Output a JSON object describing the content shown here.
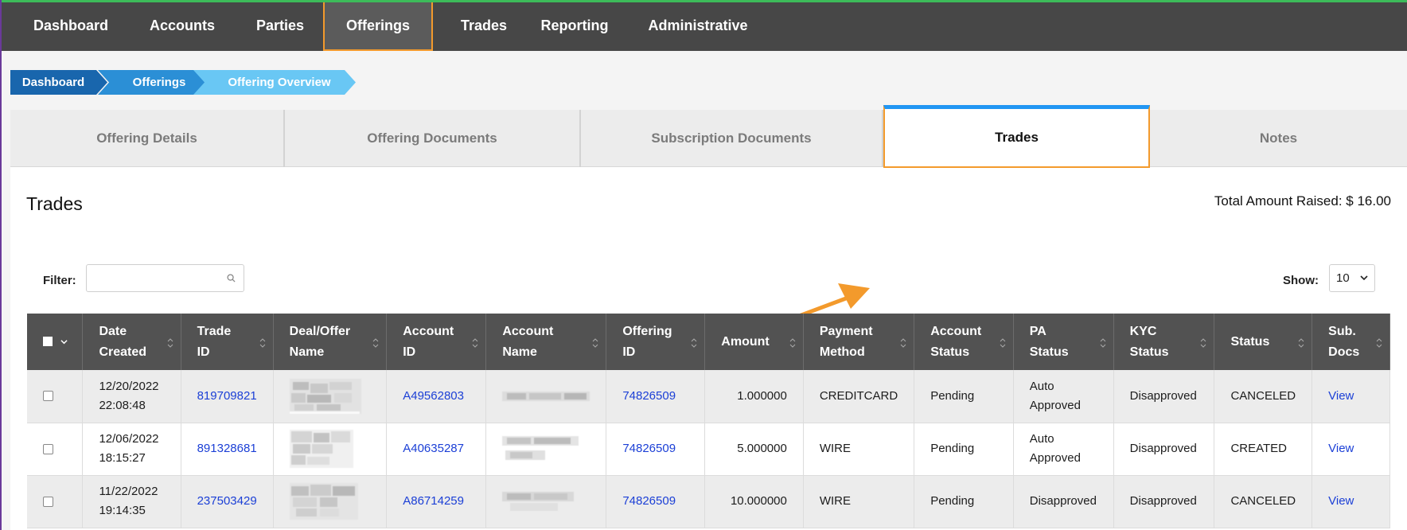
{
  "nav": {
    "items": [
      {
        "label": "Dashboard",
        "active": false
      },
      {
        "label": "Accounts",
        "active": false
      },
      {
        "label": "Parties",
        "active": false
      },
      {
        "label": "Offerings",
        "active": true
      },
      {
        "label": "Trades",
        "active": false
      },
      {
        "label": "Reporting",
        "active": false
      },
      {
        "label": "Administrative",
        "active": false
      }
    ]
  },
  "breadcrumb": [
    "Dashboard",
    "Offerings",
    "Offering Overview"
  ],
  "tabs": [
    {
      "label": "Offering Details",
      "active": false
    },
    {
      "label": "Offering Documents",
      "active": false
    },
    {
      "label": "Subscription Documents",
      "active": false
    },
    {
      "label": "Trades",
      "active": true
    },
    {
      "label": "Notes",
      "active": false
    }
  ],
  "section": {
    "title": "Trades",
    "total_amount_raised": "Total Amount Raised: $ 16.00"
  },
  "filter": {
    "label": "Filter:",
    "value": "",
    "placeholder": ""
  },
  "show": {
    "label": "Show:",
    "value": "10"
  },
  "table": {
    "headers": [
      {
        "line1": "Date",
        "line2": "Created"
      },
      {
        "line1": "Trade",
        "line2": "ID"
      },
      {
        "line1": "Deal/Offer",
        "line2": "Name"
      },
      {
        "line1": "Account",
        "line2": "ID"
      },
      {
        "line1": "Account",
        "line2": "Name"
      },
      {
        "line1": "Offering",
        "line2": "ID"
      },
      {
        "line1": "Amount",
        "line2": ""
      },
      {
        "line1": "Payment",
        "line2": "Method"
      },
      {
        "line1": "Account",
        "line2": "Status"
      },
      {
        "line1": "PA",
        "line2": "Status"
      },
      {
        "line1": "KYC",
        "line2": "Status"
      },
      {
        "line1": "Status",
        "line2": ""
      },
      {
        "line1": "Sub.",
        "line2": "Docs"
      }
    ],
    "rows": [
      {
        "date": "12/20/2022",
        "time": "22:08:48",
        "trade_id": "819709821",
        "account_id": "A49562803",
        "offering_id": "74826509",
        "amount": "1.000000",
        "payment_method": "CREDITCARD",
        "account_status": "Pending",
        "pa_status_1": "Auto",
        "pa_status_2": "Approved",
        "kyc_status": "Disapproved",
        "status": "CANCELED",
        "sub_docs": "View"
      },
      {
        "date": "12/06/2022",
        "time": "18:15:27",
        "trade_id": "891328681",
        "account_id": "A40635287",
        "offering_id": "74826509",
        "amount": "5.000000",
        "payment_method": "WIRE",
        "account_status": "Pending",
        "pa_status_1": "Auto",
        "pa_status_2": "Approved",
        "kyc_status": "Disapproved",
        "status": "CREATED",
        "sub_docs": "View"
      },
      {
        "date": "11/22/2022",
        "time": "19:14:35",
        "trade_id": "237503429",
        "account_id": "A86714259",
        "offering_id": "74826509",
        "amount": "10.000000",
        "payment_method": "WIRE",
        "account_status": "Pending",
        "pa_status_1": "Disapproved",
        "pa_status_2": "",
        "kyc_status": "Disapproved",
        "status": "CANCELED",
        "sub_docs": "View"
      }
    ]
  },
  "colors": {
    "navbar": "#474747",
    "accent_highlight": "#f39a2c",
    "tab_active_top": "#2196f3",
    "link": "#1b3fd6",
    "table_header": "#525252"
  }
}
